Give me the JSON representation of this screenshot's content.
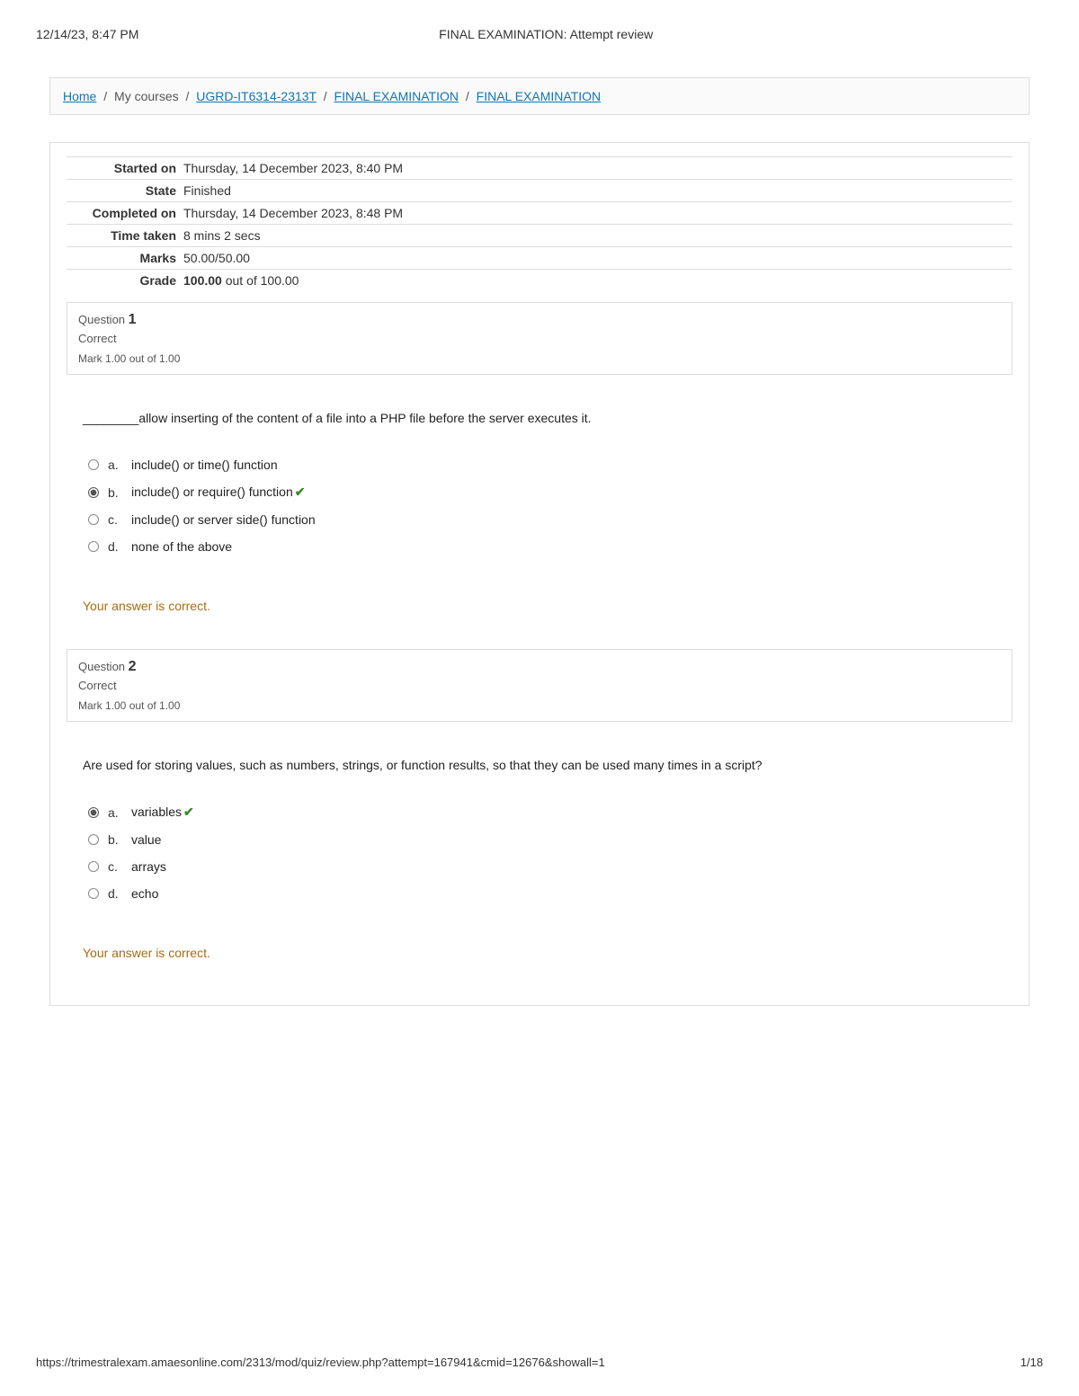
{
  "header": {
    "timestamp": "12/14/23, 8:47 PM",
    "title": "FINAL EXAMINATION: Attempt review"
  },
  "breadcrumb": {
    "home": "Home",
    "mycourses": "My courses",
    "course": "UGRD-IT6314-2313T",
    "section": "FINAL EXAMINATION",
    "activity": "FINAL EXAMINATION"
  },
  "summary": {
    "started_on_label": "Started on",
    "started_on": "Thursday, 14 December 2023, 8:40 PM",
    "state_label": "State",
    "state": "Finished",
    "completed_on_label": "Completed on",
    "completed_on": "Thursday, 14 December 2023, 8:48 PM",
    "time_taken_label": "Time taken",
    "time_taken": "8 mins 2 secs",
    "marks_label": "Marks",
    "marks": "50.00/50.00",
    "grade_label": "Grade",
    "grade_value": "100.00",
    "grade_suffix": " out of 100.00"
  },
  "q1": {
    "question_label": "Question ",
    "number": "1",
    "state": "Correct",
    "mark": "Mark 1.00 out of 1.00",
    "text": "________allow inserting of the content of a file into a PHP file before the server executes it.",
    "opts": {
      "a": {
        "letter": "a.",
        "text": "include() or time() function"
      },
      "b": {
        "letter": "b.",
        "text": "include() or require() function"
      },
      "c": {
        "letter": "c.",
        "text": "include() or server side() function"
      },
      "d": {
        "letter": "d.",
        "text": "none of the above"
      }
    },
    "feedback": "Your answer is correct."
  },
  "q2": {
    "question_label": "Question ",
    "number": "2",
    "state": "Correct",
    "mark": "Mark 1.00 out of 1.00",
    "text": "Are used for storing values, such as numbers, strings, or function results, so that they can be used many times in a script?",
    "opts": {
      "a": {
        "letter": "a.",
        "text": "variables"
      },
      "b": {
        "letter": "b.",
        "text": "value"
      },
      "c": {
        "letter": "c.",
        "text": "arrays"
      },
      "d": {
        "letter": "d.",
        "text": "echo"
      }
    },
    "feedback": "Your answer is correct."
  },
  "footer": {
    "url": "https://trimestralexam.amaesonline.com/2313/mod/quiz/review.php?attempt=167941&cmid=12676&showall=1",
    "page": "1/18"
  }
}
